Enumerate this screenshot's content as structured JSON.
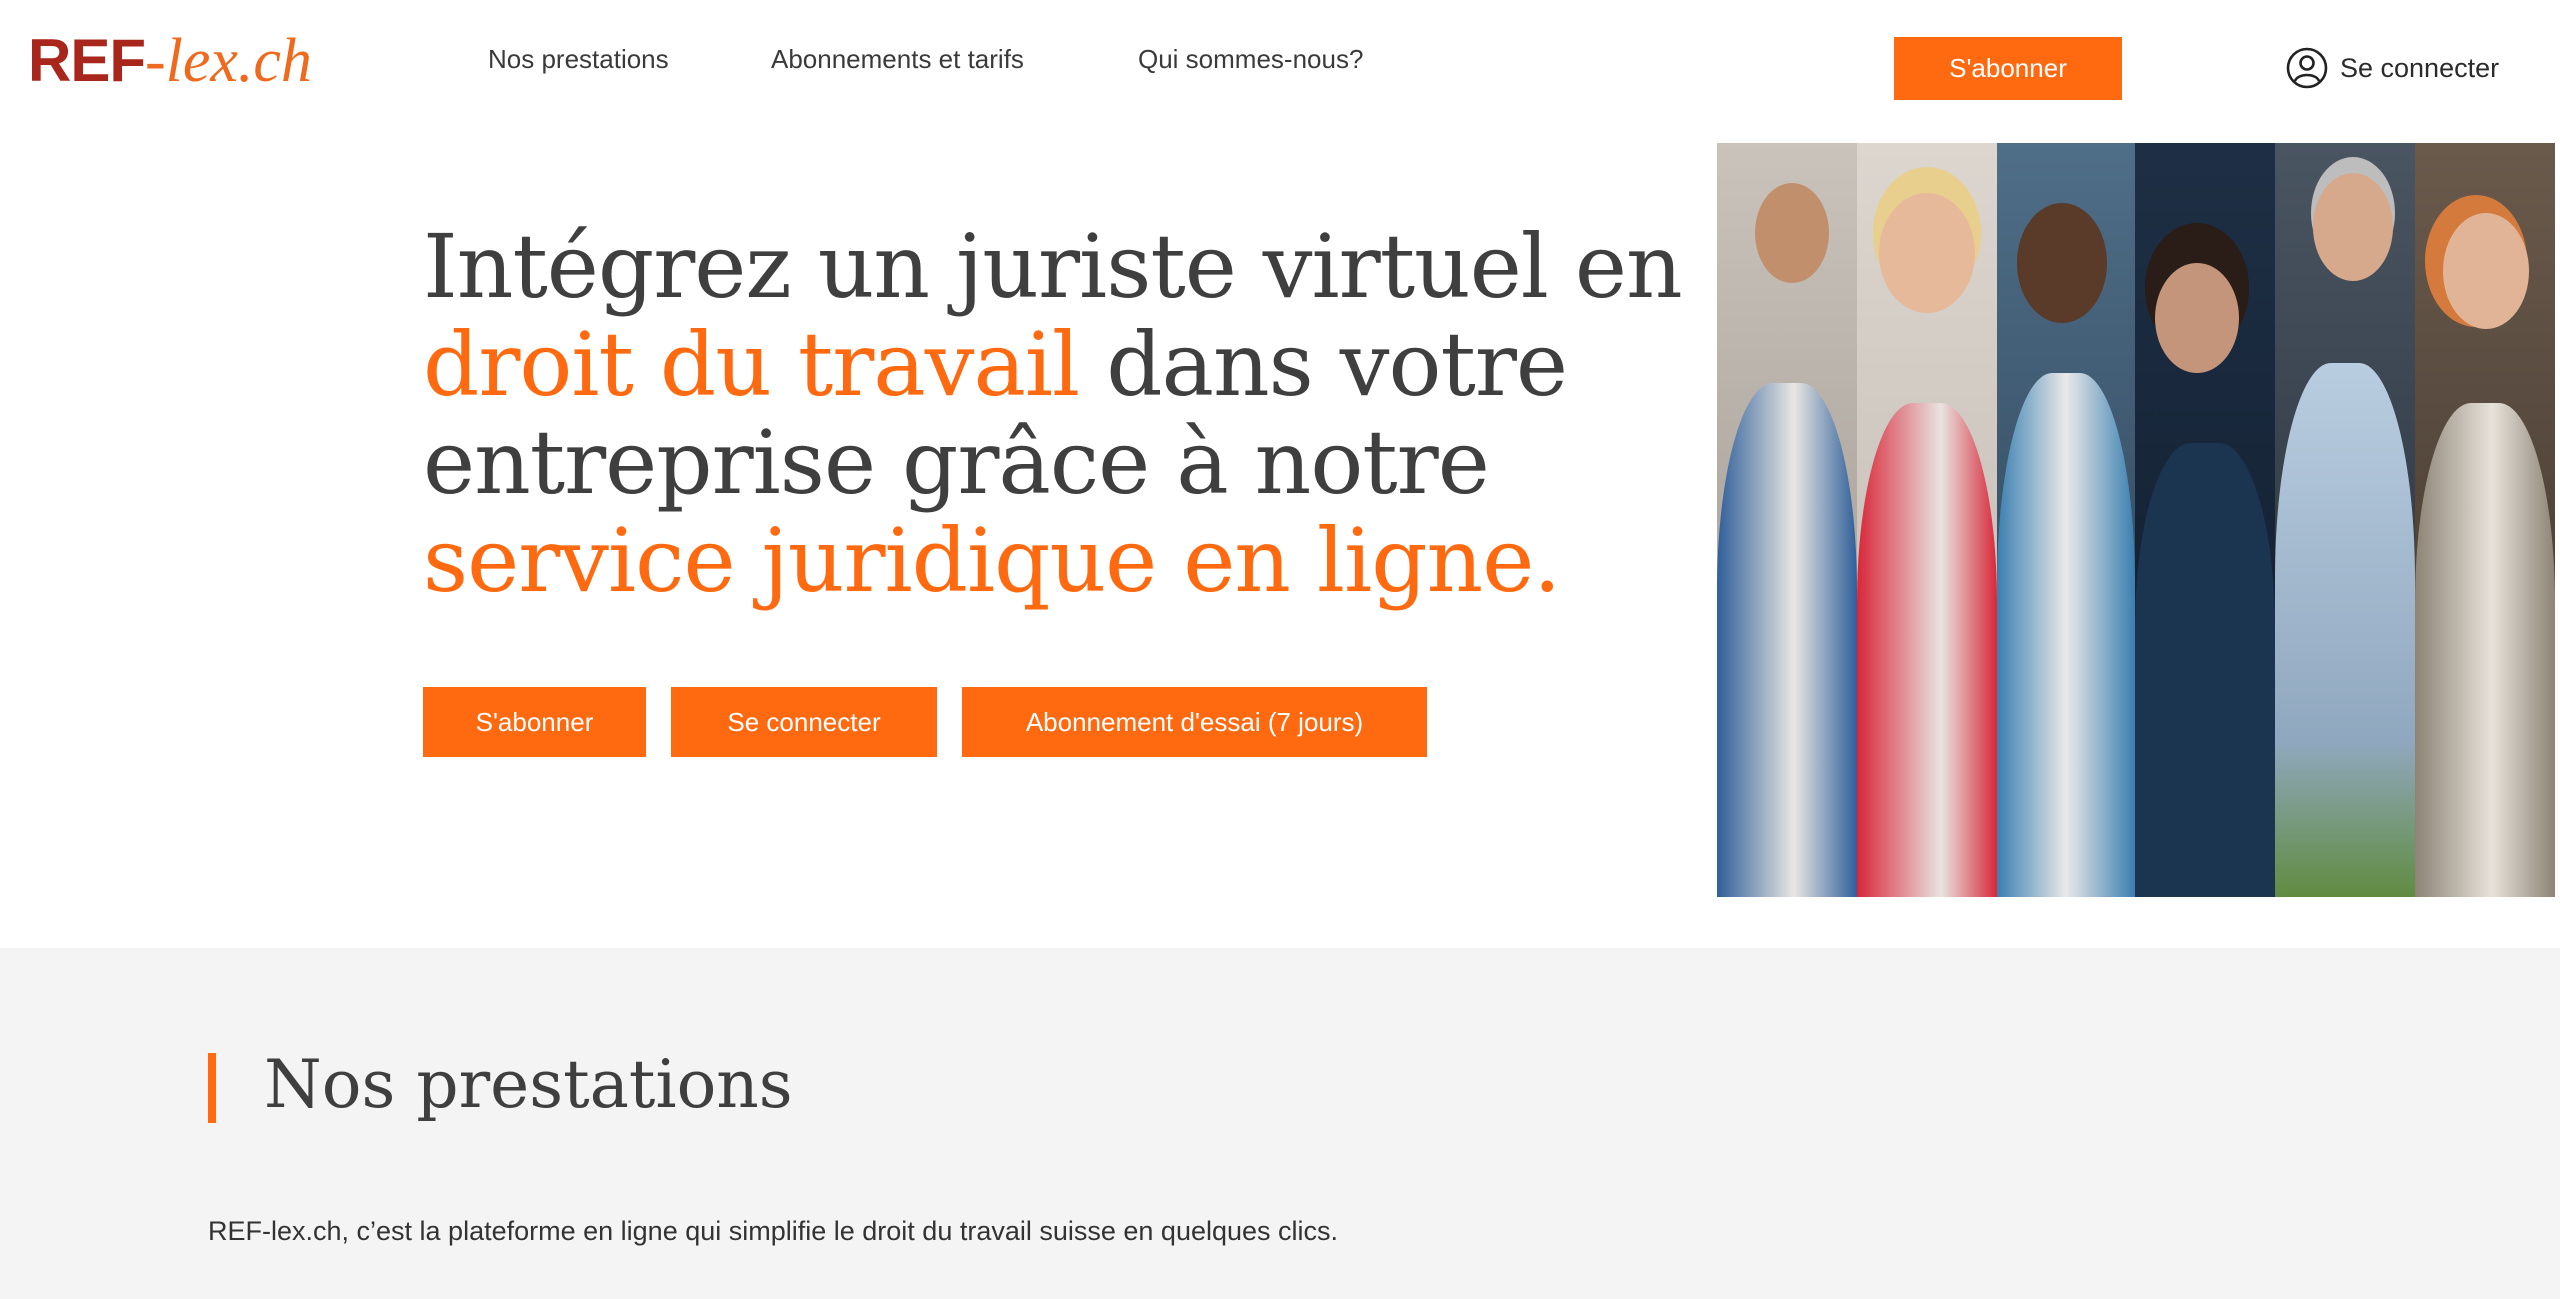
{
  "brand": {
    "logo_main": "REF",
    "logo_suffix": "-lex.ch",
    "primary_color": "#ff6a10",
    "logo_color": "#a8261b"
  },
  "header": {
    "nav": [
      {
        "label": "Nos prestations"
      },
      {
        "label": "Abonnements et tarifs"
      },
      {
        "label": "Qui sommes-nous?"
      }
    ],
    "cta_label": "S'abonner",
    "login_label": "Se connecter",
    "login_icon": "user-circle-icon"
  },
  "hero": {
    "title_1": "Intégrez un juriste virtuel en",
    "title_accent_1": "droit du travail",
    "title_2": "dans votre entreprise grâce à notre",
    "title_accent_2": "service juridique en ligne.",
    "buttons": [
      {
        "label": "S'abonner"
      },
      {
        "label": "Se connecter"
      },
      {
        "label": "Abonnement d'essai (7 jours)"
      }
    ],
    "image_alt": "people-collage-image"
  },
  "services": {
    "title": "Nos prestations",
    "text": "REF-lex.ch, c’est la plateforme en ligne qui simplifie le droit du travail suisse en quelques clics."
  }
}
